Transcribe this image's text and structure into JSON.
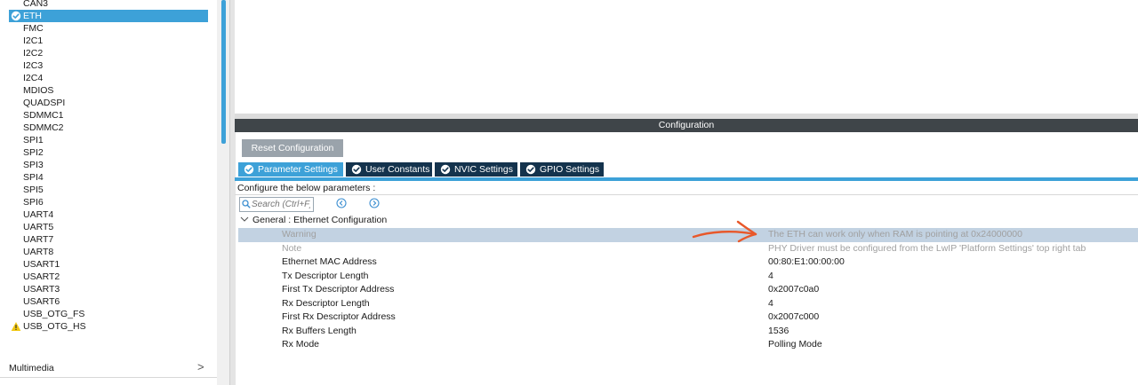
{
  "peripherals": {
    "items": [
      {
        "label": "CAN3",
        "status": "none",
        "selected": false
      },
      {
        "label": "ETH",
        "status": "ok",
        "selected": true
      },
      {
        "label": "FMC",
        "status": "none",
        "selected": false
      },
      {
        "label": "I2C1",
        "status": "none",
        "selected": false
      },
      {
        "label": "I2C2",
        "status": "none",
        "selected": false
      },
      {
        "label": "I2C3",
        "status": "none",
        "selected": false
      },
      {
        "label": "I2C4",
        "status": "none",
        "selected": false
      },
      {
        "label": "MDIOS",
        "status": "none",
        "selected": false
      },
      {
        "label": "QUADSPI",
        "status": "none",
        "selected": false
      },
      {
        "label": "SDMMC1",
        "status": "none",
        "selected": false
      },
      {
        "label": "SDMMC2",
        "status": "none",
        "selected": false
      },
      {
        "label": "SPI1",
        "status": "none",
        "selected": false
      },
      {
        "label": "SPI2",
        "status": "none",
        "selected": false
      },
      {
        "label": "SPI3",
        "status": "none",
        "selected": false
      },
      {
        "label": "SPI4",
        "status": "none",
        "selected": false
      },
      {
        "label": "SPI5",
        "status": "none",
        "selected": false
      },
      {
        "label": "SPI6",
        "status": "none",
        "selected": false
      },
      {
        "label": "UART4",
        "status": "none",
        "selected": false
      },
      {
        "label": "UART5",
        "status": "none",
        "selected": false
      },
      {
        "label": "UART7",
        "status": "none",
        "selected": false
      },
      {
        "label": "UART8",
        "status": "none",
        "selected": false
      },
      {
        "label": "USART1",
        "status": "none",
        "selected": false
      },
      {
        "label": "USART2",
        "status": "none",
        "selected": false
      },
      {
        "label": "USART3",
        "status": "none",
        "selected": false
      },
      {
        "label": "USART6",
        "status": "none",
        "selected": false
      },
      {
        "label": "USB_OTG_FS",
        "status": "none",
        "selected": false
      },
      {
        "label": "USB_OTG_HS",
        "status": "warning",
        "selected": false
      }
    ]
  },
  "category": {
    "label": "Multimedia",
    "chevron": ">"
  },
  "config": {
    "header": "Configuration",
    "reset_label": "Reset Configuration",
    "tabs": [
      {
        "label": "Parameter Settings",
        "active": true,
        "icon": "check-circle-icon"
      },
      {
        "label": "User Constants",
        "active": false,
        "icon": "check-circle-icon"
      },
      {
        "label": "NVIC Settings",
        "active": false,
        "icon": "check-circle-icon"
      },
      {
        "label": "GPIO Settings",
        "active": false,
        "icon": "check-circle-icon"
      }
    ],
    "instruction": "Configure the below parameters :",
    "search_placeholder": "Search (Ctrl+F)",
    "group_title": "General : Ethernet Configuration",
    "params": [
      {
        "name": "Warning",
        "value": "The ETH can work only when RAM is pointing at 0x24000000",
        "muted": true,
        "highlight": true
      },
      {
        "name": "Note",
        "value": "PHY Driver must be configured from the LwIP 'Platform Settings' top right tab",
        "muted": true,
        "highlight": false
      },
      {
        "name": "Ethernet MAC Address",
        "value": "00:80:E1:00:00:00",
        "muted": false,
        "highlight": false
      },
      {
        "name": "Tx Descriptor Length",
        "value": "4",
        "muted": false,
        "highlight": false
      },
      {
        "name": "First Tx Descriptor Address",
        "value": "0x2007c0a0",
        "muted": false,
        "highlight": false
      },
      {
        "name": "Rx Descriptor Length",
        "value": "4",
        "muted": false,
        "highlight": false
      },
      {
        "name": "First Rx Descriptor Address",
        "value": "0x2007c000",
        "muted": false,
        "highlight": false
      },
      {
        "name": "Rx Buffers Length",
        "value": "1536",
        "muted": false,
        "highlight": false
      },
      {
        "name": "Rx Mode",
        "value": "Polling Mode",
        "muted": false,
        "highlight": false
      }
    ]
  },
  "colors": {
    "accent": "#3da1d8",
    "tab_inactive": "#14334d",
    "header_bar": "#3f4549",
    "warning_yellow": "#f2c811",
    "annotation_orange": "#e8582a",
    "ok_green": "#3da1d8"
  }
}
